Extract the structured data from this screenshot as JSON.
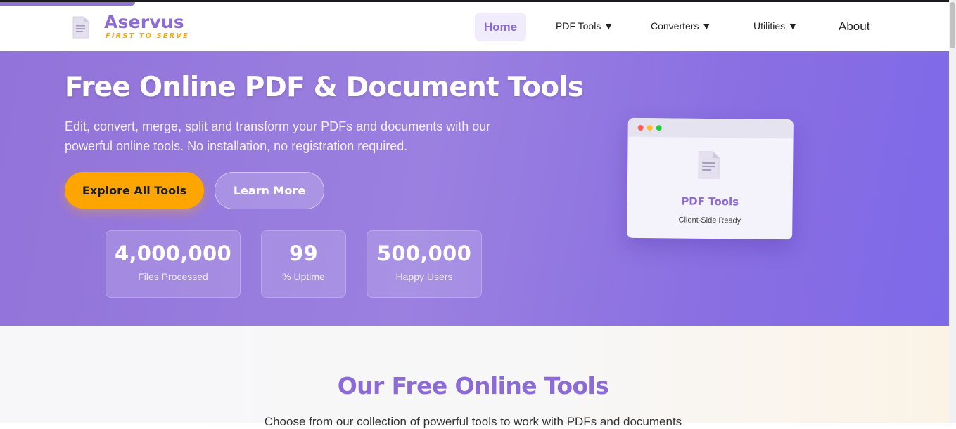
{
  "brand": {
    "name": "Aservus",
    "tagline": "FIRST TO SERVE",
    "logo_icon": "document-icon"
  },
  "nav": {
    "home": "Home",
    "items": [
      "PDF Tools ▼",
      "Converters ▼",
      "Utilities ▼"
    ],
    "about": "About"
  },
  "hero": {
    "title": "Free Online PDF & Document Tools",
    "description": "Edit, convert, merge, split and transform your PDFs and documents with our powerful online tools. No installation, no registration required.",
    "primary_button": "Explore All Tools",
    "secondary_button": "Learn More",
    "stats": [
      {
        "value": "4,000,000",
        "label": "Files Processed"
      },
      {
        "value": "99",
        "label": "% Uptime"
      },
      {
        "value": "500,000",
        "label": "Happy Users"
      }
    ],
    "mockup": {
      "title": "PDF Tools",
      "subtitle": "Client-Side Ready",
      "icon": "document-icon"
    }
  },
  "tools_section": {
    "title": "Our Free Online Tools",
    "subtitle": "Choose from our collection of powerful tools to work with PDFs and documents"
  },
  "colors": {
    "accent": "#8c6bd6",
    "cta": "#ffa500",
    "tagline": "#f4a816",
    "window_dots": [
      "#ff5f57",
      "#febc2e",
      "#28c840"
    ]
  }
}
